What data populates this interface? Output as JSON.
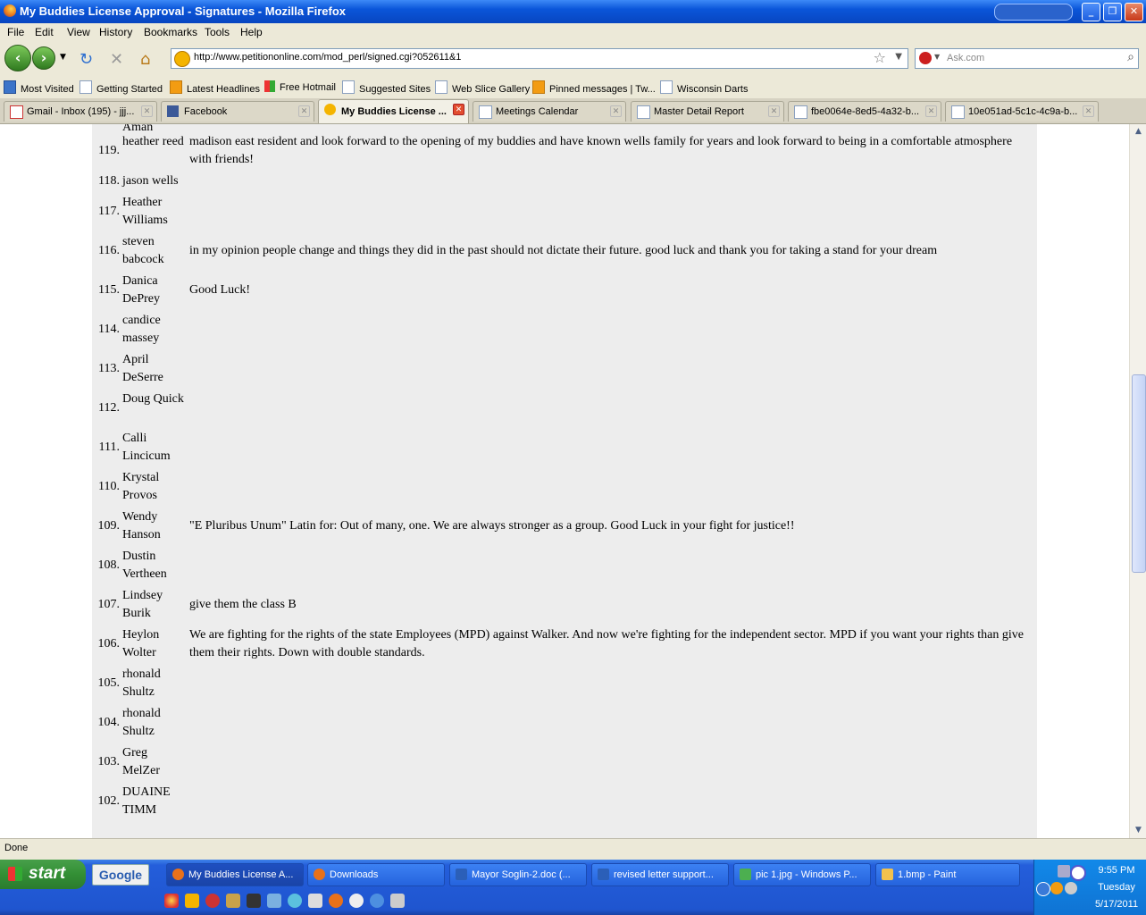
{
  "window": {
    "title": "My Buddies License Approval - Signatures - Mozilla Firefox"
  },
  "menu": [
    "File",
    "Edit",
    "View",
    "History",
    "Bookmarks",
    "Tools",
    "Help"
  ],
  "navigation": {
    "url": "http://www.petitiononline.com/mod_perl/signed.cgi?052611&1",
    "search_placeholder": "Ask.com"
  },
  "bookmarks": [
    {
      "label": "Most Visited",
      "icon": "most-visited-icon"
    },
    {
      "label": "Getting Started",
      "icon": "page-icon"
    },
    {
      "label": "Latest Headlines",
      "icon": "rss-icon"
    },
    {
      "label": "Free Hotmail",
      "icon": "windows-icon"
    },
    {
      "label": "Suggested Sites",
      "icon": "page-icon"
    },
    {
      "label": "Web Slice Gallery",
      "icon": "page-icon"
    },
    {
      "label": "Pinned messages | Tw...",
      "icon": "rss-icon"
    },
    {
      "label": "Wisconsin Darts",
      "icon": "page-icon"
    }
  ],
  "tabs": [
    {
      "label": "Gmail - Inbox (195) - jjj...",
      "icon": "gmail-icon",
      "active": false
    },
    {
      "label": "Facebook",
      "icon": "facebook-icon",
      "active": false
    },
    {
      "label": "My Buddies License ...",
      "icon": "petition-icon",
      "active": true
    },
    {
      "label": "Meetings Calendar",
      "icon": "page-icon",
      "active": false
    },
    {
      "label": "Master Detail Report",
      "icon": "page-icon",
      "active": false
    },
    {
      "label": "fbe0064e-8ed5-4a32-b...",
      "icon": "page-icon",
      "active": false
    },
    {
      "label": "10e051ad-5c1c-4c9a-b...",
      "icon": "page-icon",
      "active": false
    }
  ],
  "signatures": [
    {
      "num": "119.",
      "name": "heather reed",
      "comment": "madison east resident and look forward to the opening of my buddies and have known wells family for years and look forward to being in a comfortable atmosphere with friends!"
    },
    {
      "num": "118.",
      "name": "jason wells",
      "comment": ""
    },
    {
      "num": "117.",
      "name": "Heather Williams",
      "comment": ""
    },
    {
      "num": "116.",
      "name": "steven babcock",
      "comment": "in my opinion people change and things they did in the past should not dictate their future. good luck and thank you for taking a stand for your dream"
    },
    {
      "num": "115.",
      "name": "Danica DePrey",
      "comment": "Good Luck!"
    },
    {
      "num": "114.",
      "name": "candice massey",
      "comment": ""
    },
    {
      "num": "113.",
      "name": "April DeSerre",
      "comment": ""
    },
    {
      "num": "112.",
      "name": "Doug Quick",
      "comment": ""
    },
    {
      "num": "111.",
      "name": "Calli Lincicum",
      "comment": ""
    },
    {
      "num": "110.",
      "name": "Krystal Provos",
      "comment": ""
    },
    {
      "num": "109.",
      "name": "Wendy Hanson",
      "comment": "\"E Pluribus Unum\" Latin for: Out of many, one. We are always stronger as a group. Good Luck in your fight for justice!!"
    },
    {
      "num": "108.",
      "name": "Dustin Vertheen",
      "comment": ""
    },
    {
      "num": "107.",
      "name": "Lindsey Burik",
      "comment": "give them the class B"
    },
    {
      "num": "106.",
      "name": "Heylon Wolter",
      "comment": "We are fighting for the rights of the state Employees (MPD) against Walker. And now we're fighting for the independent sector. MPD if you want your rights than give them their rights. Down with double standards."
    },
    {
      "num": "105.",
      "name": "rhonald Shultz",
      "comment": ""
    },
    {
      "num": "104.",
      "name": "rhonald Shultz",
      "comment": ""
    },
    {
      "num": "103.",
      "name": "Greg MelZer",
      "comment": ""
    },
    {
      "num": "102.",
      "name": "DUAINE TIMM",
      "comment": ""
    }
  ],
  "partial_top_name": "Aman",
  "status": "Done",
  "taskbar": {
    "start": "start",
    "google": "Google",
    "tasks": [
      {
        "label": "My Buddies License A...",
        "icon": "firefox-icon",
        "active": true
      },
      {
        "label": "Downloads",
        "icon": "firefox-icon",
        "active": false
      },
      {
        "label": "Mayor Soglin-2.doc (...",
        "icon": "word-icon",
        "active": false
      },
      {
        "label": "revised letter support...",
        "icon": "word-icon",
        "active": false
      },
      {
        "label": "pic 1.jpg - Windows P...",
        "icon": "picture-viewer-icon",
        "active": false
      },
      {
        "label": "1.bmp - Paint",
        "icon": "paint-icon",
        "active": false
      }
    ],
    "clock": {
      "time": "9:55 PM",
      "day": "Tuesday",
      "date": "5/17/2011"
    }
  }
}
